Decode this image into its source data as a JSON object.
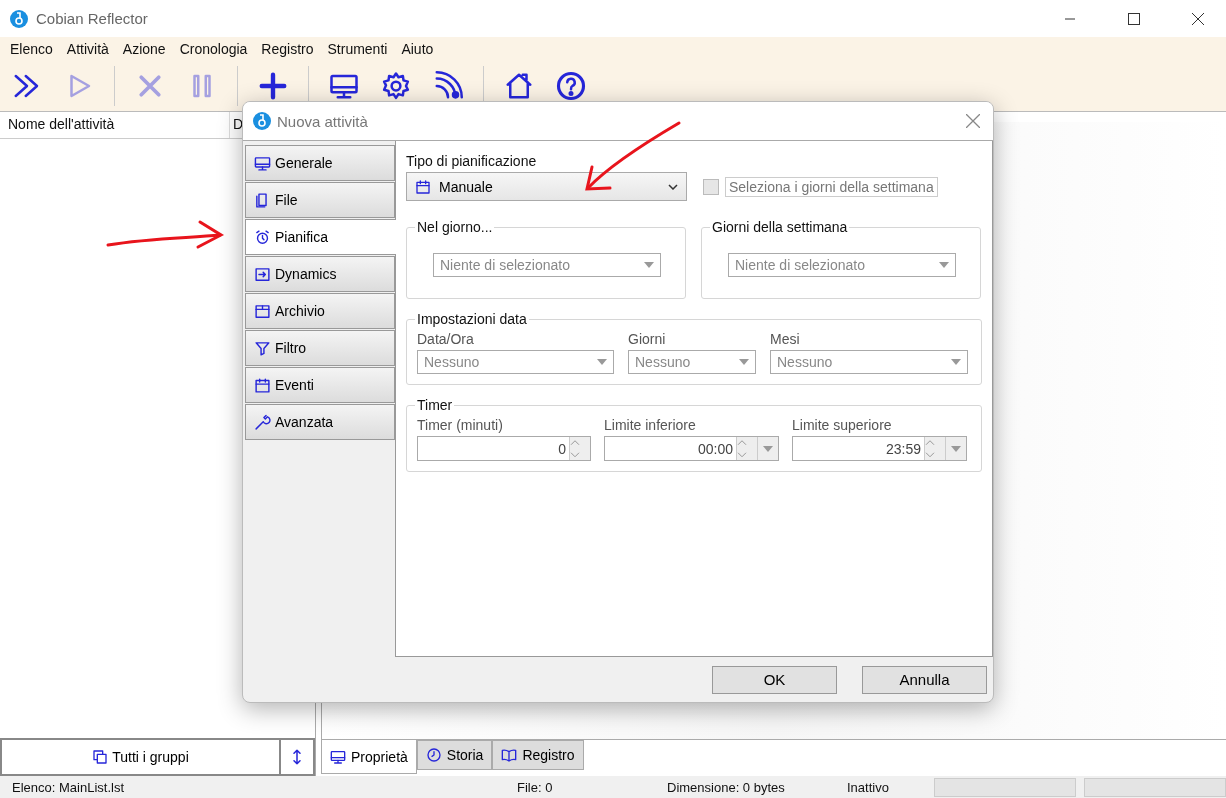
{
  "window": {
    "title": "Cobian Reflector"
  },
  "menu": [
    "Elenco",
    "Attività",
    "Azione",
    "Cronologia",
    "Registro",
    "Strumenti",
    "Aiuto"
  ],
  "toolbar": [
    {
      "kind": "run-all",
      "disabled": false
    },
    {
      "kind": "run",
      "disabled": true
    },
    {
      "kind": "stop",
      "disabled": true
    },
    {
      "kind": "pause",
      "disabled": true
    },
    {
      "kind": "add",
      "disabled": false
    },
    {
      "kind": "monitor",
      "disabled": false
    },
    {
      "kind": "gear",
      "disabled": false
    },
    {
      "kind": "signal",
      "disabled": false
    },
    {
      "kind": "home",
      "disabled": false
    },
    {
      "kind": "help",
      "disabled": false
    }
  ],
  "task_list": {
    "columns": [
      "Nome dell'attività",
      "D"
    ]
  },
  "groups_button": "Tutti i gruppi",
  "bottom_tabs": [
    {
      "label": "Proprietà",
      "selected": true
    },
    {
      "label": "Storia",
      "selected": false
    },
    {
      "label": "Registro",
      "selected": false
    }
  ],
  "status_bar": [
    "Elenco: MainList.lst",
    "File: 0",
    "Dimensione: 0 bytes",
    "Inattivo"
  ],
  "dialog": {
    "title": "Nuova attività",
    "tabs": [
      {
        "label": "Generale",
        "selected": false
      },
      {
        "label": "File",
        "selected": false
      },
      {
        "label": "Pianifica",
        "selected": true
      },
      {
        "label": "Dynamics",
        "selected": false
      },
      {
        "label": "Archivio",
        "selected": false
      },
      {
        "label": "Filtro",
        "selected": false
      },
      {
        "label": "Eventi",
        "selected": false
      },
      {
        "label": "Avanzata",
        "selected": false
      }
    ],
    "schedule_type": {
      "label": "Tipo di pianificazione",
      "value": "Manuale"
    },
    "weekdays_checkbox": {
      "label": "Seleziona i giorni della settimana",
      "checked": false,
      "disabled": true
    },
    "day_groups": [
      {
        "title": "Nel giorno...",
        "value": "Niente di selezionato"
      },
      {
        "title": "Giorni della settimana",
        "value": "Niente di selezionato"
      }
    ],
    "date_settings": {
      "title": "Impostazioni data",
      "fields": [
        {
          "label": "Data/Ora",
          "value": "Nessuno"
        },
        {
          "label": "Giorni",
          "value": "Nessuno"
        },
        {
          "label": "Mesi",
          "value": "Nessuno"
        }
      ]
    },
    "timer": {
      "title": "Timer",
      "fields": [
        {
          "label": "Timer (minuti)",
          "value": "0",
          "kind": "spin"
        },
        {
          "label": "Limite inferiore",
          "value": "00:00",
          "kind": "spin-drop"
        },
        {
          "label": "Limite superiore",
          "value": "23:59",
          "kind": "spin-drop"
        }
      ]
    },
    "buttons": [
      "OK",
      "Annulla"
    ]
  }
}
